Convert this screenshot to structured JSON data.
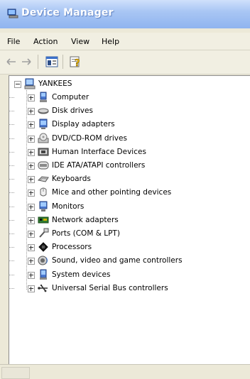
{
  "window": {
    "title": "Device Manager"
  },
  "menu": [
    "File",
    "Action",
    "View",
    "Help"
  ],
  "tree": {
    "root": {
      "label": "YANKEES",
      "icon": "computer-icon"
    },
    "items": [
      {
        "label": "Computer",
        "icon": "computer-icon"
      },
      {
        "label": "Disk drives",
        "icon": "disk-drive-icon"
      },
      {
        "label": "Display adapters",
        "icon": "display-adapter-icon"
      },
      {
        "label": "DVD/CD-ROM drives",
        "icon": "cd-drive-icon"
      },
      {
        "label": "Human Interface Devices",
        "icon": "hid-icon"
      },
      {
        "label": "IDE ATA/ATAPI controllers",
        "icon": "ide-controller-icon"
      },
      {
        "label": "Keyboards",
        "icon": "keyboard-icon"
      },
      {
        "label": "Mice and other pointing devices",
        "icon": "mouse-icon"
      },
      {
        "label": "Monitors",
        "icon": "monitor-icon"
      },
      {
        "label": "Network adapters",
        "icon": "network-adapter-icon"
      },
      {
        "label": "Ports (COM & LPT)",
        "icon": "port-icon"
      },
      {
        "label": "Processors",
        "icon": "processor-icon"
      },
      {
        "label": "Sound, video and game controllers",
        "icon": "sound-icon"
      },
      {
        "label": "System devices",
        "icon": "system-devices-icon"
      },
      {
        "label": "Universal Serial Bus controllers",
        "icon": "usb-icon"
      }
    ]
  },
  "colors": {
    "titlebar": "#a9c6f4",
    "title_text": "#ffffff",
    "chrome": "#ece9d8",
    "tree_bg": "#ffffff"
  }
}
